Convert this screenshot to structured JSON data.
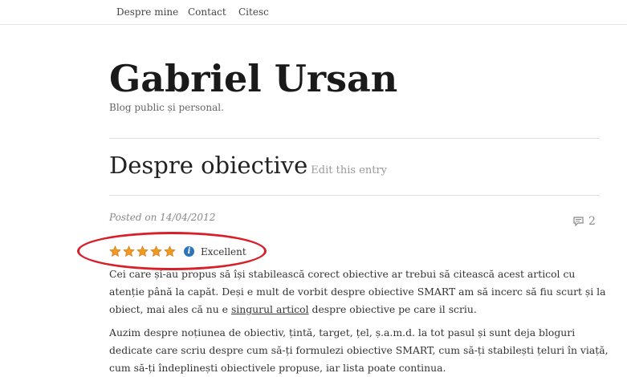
{
  "nav": {
    "items": [
      "Despre mine",
      "Contact",
      "Citesc"
    ]
  },
  "site": {
    "title": "Gabriel Ursan",
    "description": "Blog public și personal."
  },
  "entry": {
    "title": "Despre obiective",
    "edit_link": "Edit this entry",
    "posted_label": "Posted on",
    "date": "14/04/2012",
    "comment_count": "2"
  },
  "rating": {
    "stars": 5,
    "max": 5,
    "label": "Excellent",
    "info_icon": "i",
    "star_color": "#f29a1f"
  },
  "highlight_color": "#d8202a",
  "body": {
    "p1_before": "Cei care și-au propus să își stabilească corect obiective ar trebui să citească acest articol cu atenție până la capăt. Deși e mult de vorbit despre obiective SMART am să incerc să fiu scurt și la obiect, mai ales că nu e ",
    "p1_link": "singurul articol",
    "p1_after": " despre obiective pe care il scriu.",
    "p2": "Auzim despre noțiunea de obiectiv, țintă, target, țel, ș.a.m.d. la tot pasul și sunt deja bloguri dedicate care scriu despre cum să-ți formulezi obiective SMART, cum să-ți stabilești țeluri în viață, cum să-ți îndeplinești obiectivele propuse, iar lista poate continua."
  }
}
